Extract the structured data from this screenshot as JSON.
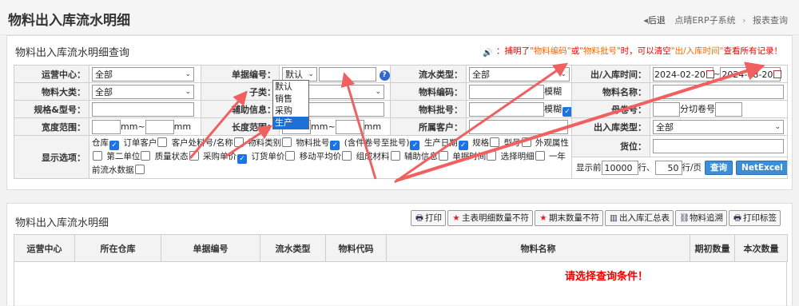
{
  "header": {
    "title": "物料出入库流水明细",
    "back_label": "后退",
    "breadcrumb": [
      "点晴ERP子系统",
      "报表查询"
    ]
  },
  "query": {
    "title": "物料出入库流水明细查询",
    "hint_prefix": "：捕明了",
    "hint_material_code": "\"物料编码\"",
    "hint_or": "或",
    "hint_batch": "\"物料批号\"",
    "hint_mid": "时，可以清空",
    "hint_time": "\"出/入库时间\"",
    "hint_all": "查看所有记录！",
    "labels": {
      "ops_center": "运营中心：",
      "doc_no": "单据编号：",
      "flow_type": "流水类型：",
      "io_time": "出/入库时间：",
      "category": "物料大类：",
      "subcategory": "子类：",
      "material_code": "物料编码：",
      "material_name": "物料名称：",
      "spec_model": "规格&型号：",
      "aux_info": "辅助信息：",
      "batch_no": "物料批号：",
      "mother_roll": "母卷号：",
      "width_range": "宽度范围：",
      "length_range": "长度范围：",
      "customer": "所属客户：",
      "io_type": "出入库类型：",
      "display_opts": "显示选项：",
      "location": "货位："
    },
    "values": {
      "ops_center": "全部",
      "doc_prefix": "默认",
      "flow_type": "全部",
      "date_from": "2024-02-20",
      "date_to": "2024-08-20",
      "category": "全部",
      "io_type": "全部",
      "show_first": "10000",
      "per_page": "50"
    },
    "units": {
      "mm": "mm",
      "tilde": "~",
      "fuzzy": "模糊",
      "split_roll": "分切卷号",
      "show_first_prefix": "显示前",
      "rows": "行、",
      "rows_per_page": "行/页"
    },
    "doc_dropdown": [
      "默认",
      "销售",
      "采购",
      "生产"
    ],
    "display_options": [
      {
        "label": "仓库",
        "checked": true
      },
      {
        "label": "订单客户",
        "checked": false
      },
      {
        "label": "客户处料号/名称",
        "checked": false
      },
      {
        "label": "物料类别",
        "checked": false
      },
      {
        "label": "物料批号",
        "checked": true
      },
      {
        "label": "(含件卷号至批号)",
        "checked": true
      },
      {
        "label": "生产日期",
        "checked": true
      },
      {
        "label": "规格",
        "checked": false
      },
      {
        "label": "型号",
        "checked": false
      },
      {
        "label": "外观属性",
        "checked": false
      },
      {
        "label": "第二单位",
        "checked": false
      },
      {
        "label": "质量状态",
        "checked": false
      },
      {
        "label": "采购单价",
        "checked": true
      },
      {
        "label": "订货单价",
        "checked": false
      },
      {
        "label": "移动平均价",
        "checked": false
      },
      {
        "label": "组成材料",
        "checked": false
      },
      {
        "label": "辅助信息",
        "checked": false
      },
      {
        "label": "单据时间",
        "checked": false
      },
      {
        "label": "选择明细",
        "checked": false
      },
      {
        "label": "一年前流水数据",
        "checked": false
      }
    ],
    "search_label": "查询",
    "export_label": "NetExcel"
  },
  "list": {
    "title": "物料出入库流水明细",
    "toolbar": [
      {
        "icon": "printer-icon",
        "glyph": "🖶",
        "label": "打印"
      },
      {
        "icon": "star-icon",
        "glyph": "★",
        "label": "主表明细数量不符"
      },
      {
        "icon": "star-icon",
        "glyph": "★",
        "label": "期末数量不符"
      },
      {
        "icon": "chart-icon",
        "glyph": "▥",
        "label": "出入库汇总表"
      },
      {
        "icon": "trace-icon",
        "glyph": "⛓",
        "label": "物料追溯"
      },
      {
        "icon": "printer-icon",
        "glyph": "🖶",
        "label": "打印标签"
      }
    ],
    "columns": [
      "运营中心",
      "所在仓库",
      "单据编号",
      "流水类型",
      "物料代码",
      "物料名称",
      "期初数量",
      "本次数量"
    ],
    "empty_message": "请选择查询条件！"
  },
  "colors": {
    "accent": "#1a73e8",
    "warning": "#e00000",
    "arrow": "#f06060"
  }
}
